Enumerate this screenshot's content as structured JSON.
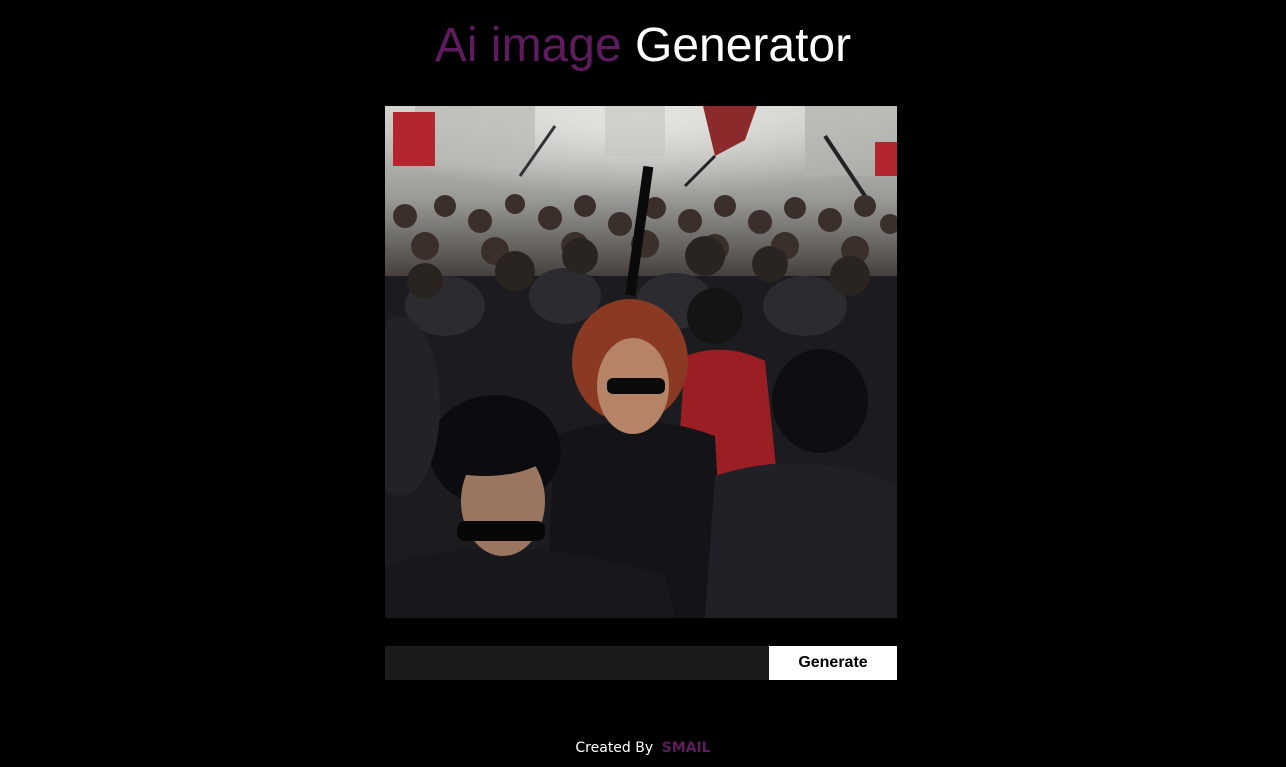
{
  "header": {
    "title_accent": "Ai image",
    "title_main": "Generator",
    "accent_color": "#5e1b5e"
  },
  "main": {
    "image": {
      "icon": "generated-image",
      "subject": "crowd of people in black leather jackets with flags"
    },
    "prompt_input": {
      "value": "",
      "placeholder": ""
    },
    "generate_label": "Generate"
  },
  "footer": {
    "created_by_label": "Created By",
    "author": "SMAIL"
  }
}
